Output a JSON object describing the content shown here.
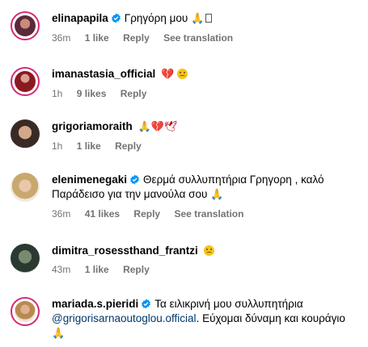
{
  "comments": [
    {
      "username": "elinapapila",
      "verified": true,
      "text": "Γρηγόρη μου",
      "emoji": "🙏",
      "time": "36m",
      "likes": "1 like",
      "reply": "Reply",
      "translation": "See translation"
    },
    {
      "username": "imanastasia_official",
      "verified": false,
      "text": "",
      "emoji": "💔",
      "time": "1h",
      "likes": "9 likes",
      "reply": "Reply"
    },
    {
      "username": "grigoriamoraith",
      "verified": false,
      "text": "",
      "emoji": "🙏💔🕊",
      "time": "1h",
      "likes": "1 like",
      "reply": "Reply"
    },
    {
      "username": "elenimenegaki",
      "verified": true,
      "text": "Θερμά συλλυπητήρια Γρηγορη , καλό Παράδεισο για την μανούλα σου",
      "emoji": "🙏",
      "time": "36m",
      "likes": "41 likes",
      "reply": "Reply",
      "translation": "See translation"
    },
    {
      "username": "dimitra_rosessthand_frantzi",
      "verified": false,
      "text": "",
      "emoji": "",
      "time": "43m",
      "likes": "1 like",
      "reply": "Reply"
    },
    {
      "username": "mariada.s.pieridi",
      "verified": true,
      "text": "Τα ειλικρινή μου συλλυπητήρια",
      "mention": "@grigorisarnaoutoglou.official",
      "text2": ". Εύχομαι δύναμη και κουράγιο",
      "emoji": "🙏"
    }
  ],
  "colors": {
    "verified": "#0095f6",
    "meta": "#737373",
    "mention": "#00376b"
  },
  "icons": [
    "verified-badge-icon",
    "folded-hands-icon",
    "broken-heart-icon",
    "sad-face-icon",
    "dove-icon"
  ]
}
